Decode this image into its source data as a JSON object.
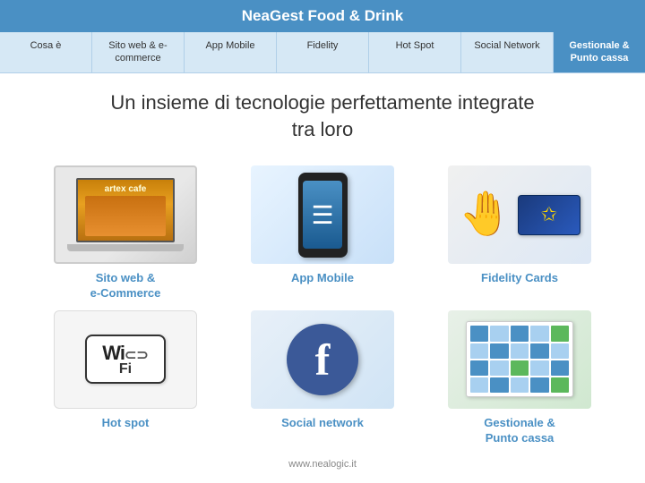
{
  "header": {
    "title": "NeaGest Food & Drink"
  },
  "navbar": {
    "items": [
      {
        "id": "cosa-e",
        "label": "Cosa è",
        "active": false
      },
      {
        "id": "sito-web",
        "label": "Sito web & e-commerce",
        "active": false
      },
      {
        "id": "app-mobile",
        "label": "App Mobile",
        "active": false
      },
      {
        "id": "fidelity",
        "label": "Fidelity",
        "active": false
      },
      {
        "id": "hot-spot",
        "label": "Hot Spot",
        "active": false
      },
      {
        "id": "social-network",
        "label": "Social Network",
        "active": false
      },
      {
        "id": "gestionale",
        "label": "Gestionale & Punto cassa",
        "active": true
      }
    ]
  },
  "main": {
    "tagline_line1": "Un insieme di tecnologie perfettamente integrate",
    "tagline_line2": "tra loro"
  },
  "grid": {
    "items": [
      {
        "id": "sito-web",
        "label": "Sito web &\ne-Commerce",
        "type": "laptop"
      },
      {
        "id": "app-mobile",
        "label": "App Mobile",
        "type": "phone"
      },
      {
        "id": "fidelity",
        "label": "Fidelity Cards",
        "type": "card"
      },
      {
        "id": "hot-spot",
        "label": "Hot spot",
        "type": "wifi"
      },
      {
        "id": "social-network",
        "label": "Social network",
        "type": "facebook"
      },
      {
        "id": "gestionale",
        "label": "Gestionale &\nPunto cassa",
        "type": "pos"
      }
    ]
  },
  "footer": {
    "url": "www.nealogic.it"
  }
}
